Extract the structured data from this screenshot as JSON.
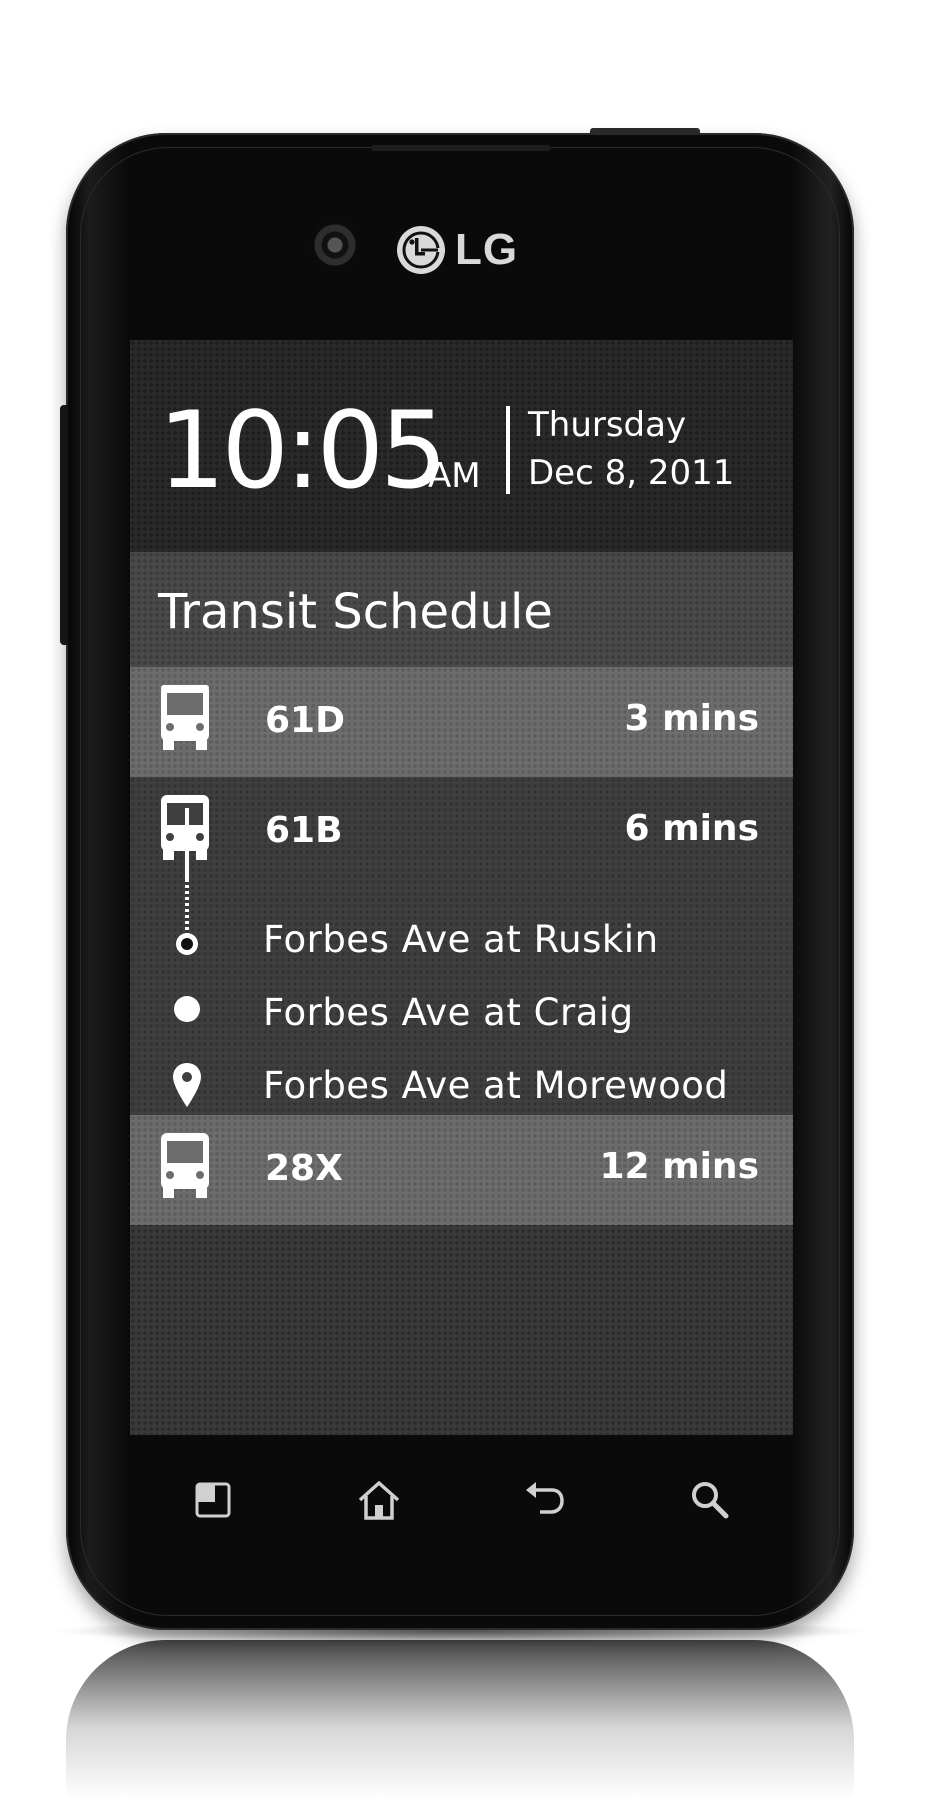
{
  "device": {
    "brand": "LG"
  },
  "clock": {
    "time": "10:05",
    "ampm": "AM",
    "day": "Thursday",
    "date": "Dec 8, 2011"
  },
  "schedule": {
    "title": "Transit Schedule",
    "routes": [
      {
        "name": "61D",
        "eta": "3 mins",
        "icon": "bus-icon"
      },
      {
        "name": "61B",
        "eta": "6 mins",
        "icon": "bus-icon",
        "stops": [
          {
            "label": "Forbes Ave at Ruskin",
            "marker": "stop-origin-dot"
          },
          {
            "label": "Forbes Ave at Craig",
            "marker": "stop-current-dot"
          },
          {
            "label": "Forbes Ave at Morewood",
            "marker": "map-pin-icon"
          }
        ]
      },
      {
        "name": "28X",
        "eta": "12 mins",
        "icon": "bus-icon"
      }
    ]
  },
  "nav": {
    "buttons": [
      "menu-icon",
      "home-icon",
      "back-icon",
      "search-icon"
    ]
  },
  "colors": {
    "text": "#ffffff",
    "row_highlight": "#6d6d6d",
    "row_expanded": "#3f3f3f",
    "header_band": "#4a4a4a",
    "clock_band": "#2a2a2a",
    "bezel": "#0a0a0a"
  }
}
